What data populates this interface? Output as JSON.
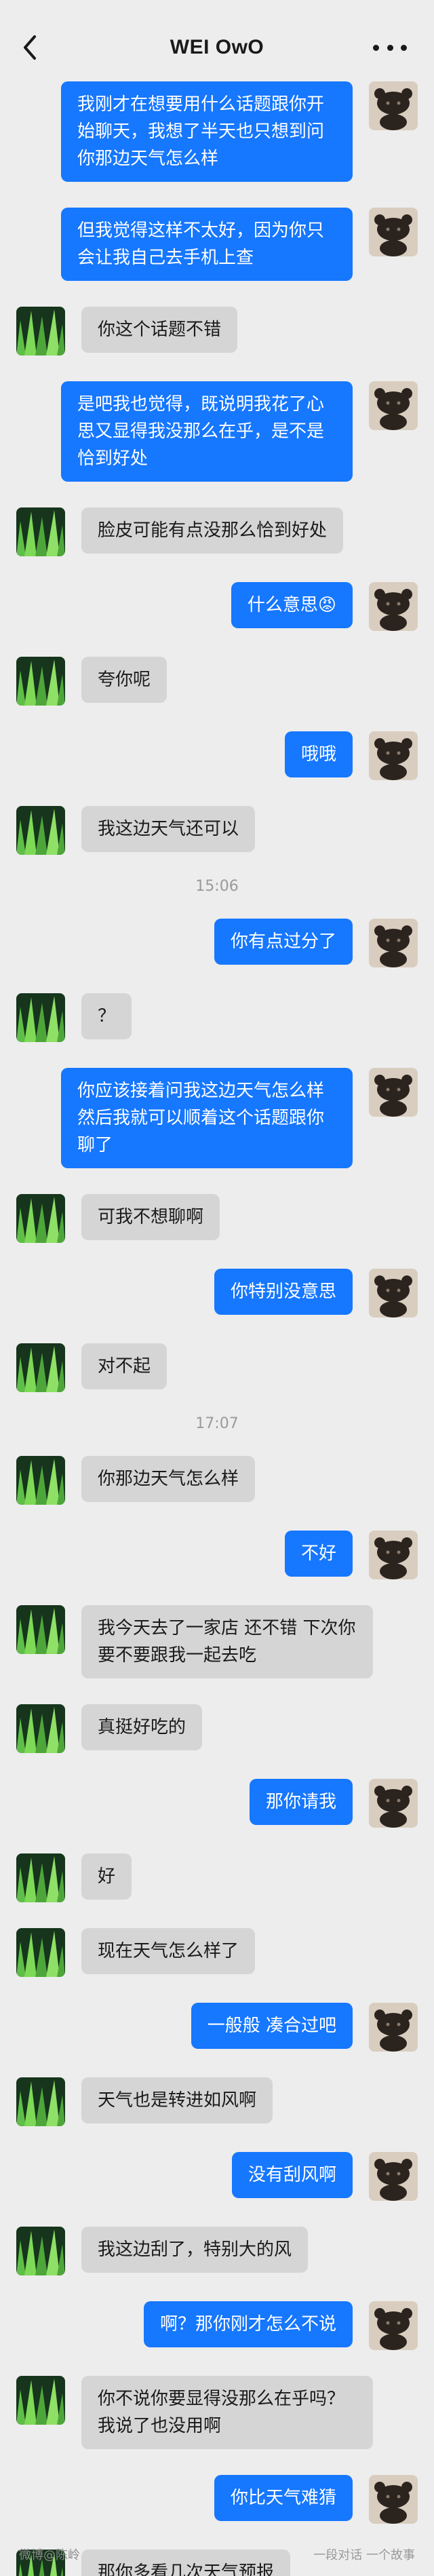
{
  "header": {
    "title": "WEI OwO",
    "back_icon": "chevron-left-icon",
    "more_icon": "more-dots-icon"
  },
  "colors": {
    "background": "#ededed",
    "sent_bubble": "#1677ff",
    "received_bubble": "#d5d5d5"
  },
  "messages": [
    {
      "type": "msg",
      "side": "right",
      "text": "我刚才在想要用什么话题跟你开始聊天，我想了半天也只想到问你那边天气怎么样"
    },
    {
      "type": "msg",
      "side": "right",
      "text": "但我觉得这样不太好，因为你只会让我自己去手机上查"
    },
    {
      "type": "msg",
      "side": "left",
      "text": "你这个话题不错"
    },
    {
      "type": "msg",
      "side": "right",
      "text": "是吧我也觉得，既说明我花了心思又显得我没那么在乎，是不是恰到好处"
    },
    {
      "type": "msg",
      "side": "left",
      "text": "脸皮可能有点没那么恰到好处"
    },
    {
      "type": "msg",
      "side": "right",
      "text": "什么意思😡"
    },
    {
      "type": "msg",
      "side": "left",
      "text": "夸你呢"
    },
    {
      "type": "msg",
      "side": "right",
      "text": "哦哦"
    },
    {
      "type": "msg",
      "side": "left",
      "text": "我这边天气还可以"
    },
    {
      "type": "time",
      "text": "15:06"
    },
    {
      "type": "msg",
      "side": "right",
      "text": "你有点过分了"
    },
    {
      "type": "msg",
      "side": "left",
      "text": "？"
    },
    {
      "type": "msg",
      "side": "right",
      "text": "你应该接着问我这边天气怎么样 然后我就可以顺着这个话题跟你聊了"
    },
    {
      "type": "msg",
      "side": "left",
      "text": "可我不想聊啊"
    },
    {
      "type": "msg",
      "side": "right",
      "text": "你特别没意思"
    },
    {
      "type": "msg",
      "side": "left",
      "text": "对不起"
    },
    {
      "type": "time",
      "text": "17:07"
    },
    {
      "type": "msg",
      "side": "left",
      "text": "你那边天气怎么样"
    },
    {
      "type": "msg",
      "side": "right",
      "text": "不好"
    },
    {
      "type": "msg",
      "side": "left",
      "text": "我今天去了一家店 还不错 下次你要不要跟我一起去吃"
    },
    {
      "type": "msg",
      "side": "left",
      "text": "真挺好吃的"
    },
    {
      "type": "msg",
      "side": "right",
      "text": "那你请我"
    },
    {
      "type": "msg",
      "side": "left",
      "text": "好"
    },
    {
      "type": "msg",
      "side": "left",
      "text": "现在天气怎么样了"
    },
    {
      "type": "msg",
      "side": "right",
      "text": "一般般 凑合过吧"
    },
    {
      "type": "msg",
      "side": "left",
      "text": "天气也是转进如风啊"
    },
    {
      "type": "msg",
      "side": "right",
      "text": "没有刮风啊"
    },
    {
      "type": "msg",
      "side": "left",
      "text": "我这边刮了，特别大的风"
    },
    {
      "type": "msg",
      "side": "right",
      "text": "啊？那你刚才怎么不说"
    },
    {
      "type": "msg",
      "side": "left",
      "text": "你不说你要显得没那么在乎吗？我说了也没用啊"
    },
    {
      "type": "msg",
      "side": "right",
      "text": "你比天气难猜"
    },
    {
      "type": "msg",
      "side": "left",
      "text": "那你多看几次天气预报"
    }
  ],
  "watermark": {
    "left": "微博@陈岭",
    "right": "一段对话 一个故事"
  }
}
